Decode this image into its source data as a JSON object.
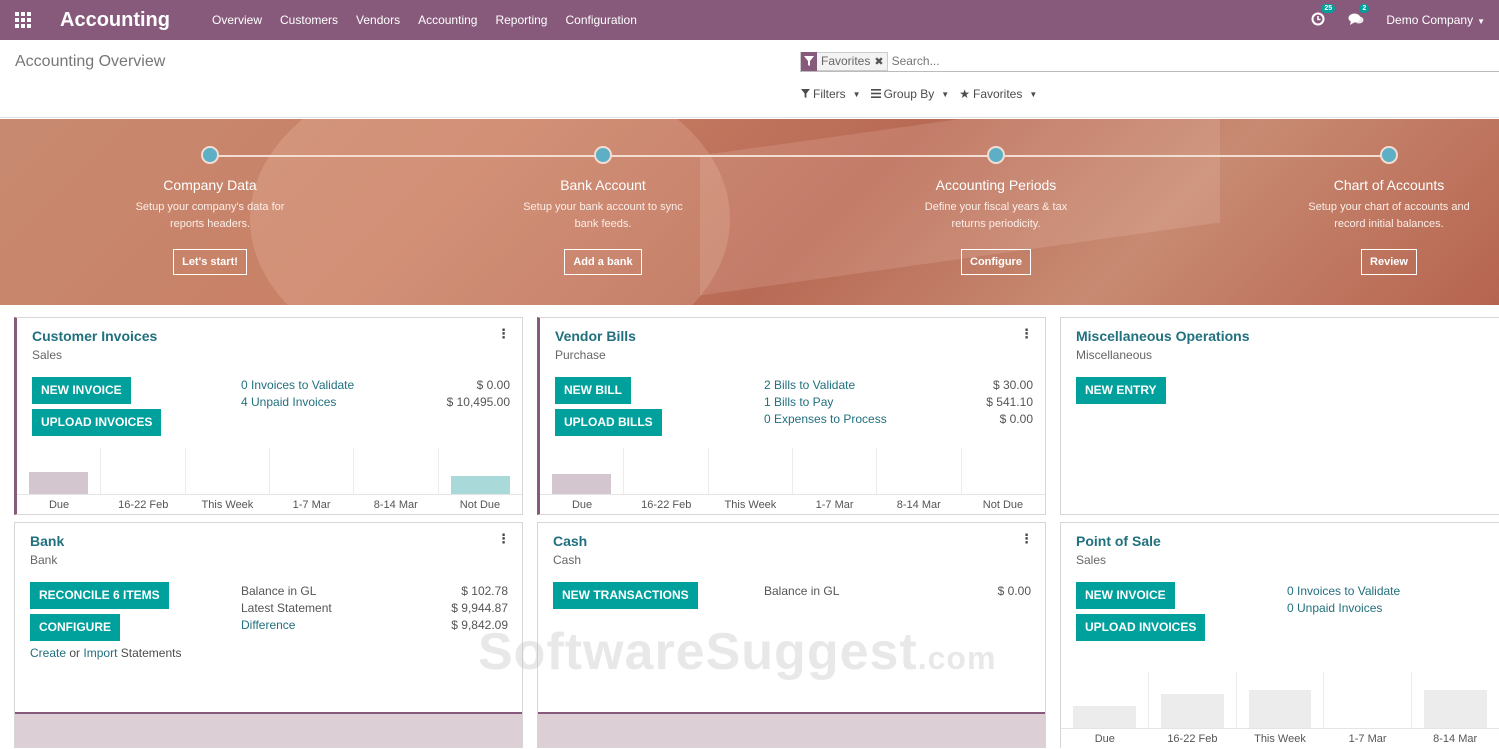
{
  "navbar": {
    "app_name": "Accounting",
    "menu": [
      "Overview",
      "Customers",
      "Vendors",
      "Accounting",
      "Reporting",
      "Configuration"
    ],
    "activity_count": "25",
    "message_count": "2",
    "company": "Demo Company"
  },
  "control_panel": {
    "title": "Accounting Overview",
    "search": {
      "facet": "Favorites",
      "placeholder": "Search..."
    },
    "filters_label": "Filters",
    "groupby_label": "Group By",
    "favorites_label": "Favorites"
  },
  "onboarding": {
    "steps": [
      {
        "title": "Company Data",
        "desc": "Setup your company's data for reports headers.",
        "button": "Let's start!"
      },
      {
        "title": "Bank Account",
        "desc": "Setup your bank account to sync bank feeds.",
        "button": "Add a bank"
      },
      {
        "title": "Accounting Periods",
        "desc": "Define your fiscal years & tax returns periodicity.",
        "button": "Configure"
      },
      {
        "title": "Chart of Accounts",
        "desc": "Setup your chart of accounts and record initial balances.",
        "button": "Review"
      }
    ]
  },
  "journals": {
    "customer_invoices": {
      "title": "Customer Invoices",
      "subtitle": "Sales",
      "buttons": [
        "NEW INVOICE",
        "UPLOAD INVOICES"
      ],
      "stats": [
        {
          "label": "0 Invoices to Validate",
          "value": "$ 0.00"
        },
        {
          "label": "4 Unpaid Invoices",
          "value": "$ 10,495.00"
        }
      ],
      "chart_labels": [
        "Due",
        "16-22 Feb",
        "This Week",
        "1-7 Mar",
        "8-14 Mar",
        "Not Due"
      ]
    },
    "vendor_bills": {
      "title": "Vendor Bills",
      "subtitle": "Purchase",
      "buttons": [
        "NEW BILL",
        "UPLOAD BILLS"
      ],
      "stats": [
        {
          "label": "2 Bills to Validate",
          "value": "$ 30.00"
        },
        {
          "label": "1 Bills to Pay",
          "value": "$ 541.10"
        },
        {
          "label": "0 Expenses to Process",
          "value": "$ 0.00"
        }
      ],
      "chart_labels": [
        "Due",
        "16-22 Feb",
        "This Week",
        "1-7 Mar",
        "8-14 Mar",
        "Not Due"
      ]
    },
    "misc": {
      "title": "Miscellaneous Operations",
      "subtitle": "Miscellaneous",
      "buttons": [
        "NEW ENTRY"
      ]
    },
    "bank": {
      "title": "Bank",
      "subtitle": "Bank",
      "buttons": [
        "RECONCILE 6 ITEMS",
        "CONFIGURE"
      ],
      "stats": [
        {
          "label": "Balance in GL",
          "value": "$ 102.78"
        },
        {
          "label": "Latest Statement",
          "value": "$ 9,944.87"
        },
        {
          "label": "Difference",
          "value": "$ 9,842.09"
        }
      ],
      "statements": {
        "create": "Create",
        "or": "or",
        "import": "Import",
        "suffix": "Statements"
      }
    },
    "cash": {
      "title": "Cash",
      "subtitle": "Cash",
      "buttons": [
        "NEW TRANSACTIONS"
      ],
      "stats": [
        {
          "label": "Balance in GL",
          "value": "$ 0.00"
        }
      ]
    },
    "pos": {
      "title": "Point of Sale",
      "subtitle": "Sales",
      "buttons": [
        "NEW INVOICE",
        "UPLOAD INVOICES"
      ],
      "stats": [
        {
          "label": "0 Invoices to Validate",
          "value": ""
        },
        {
          "label": "0 Unpaid Invoices",
          "value": ""
        }
      ],
      "chart_labels": [
        "Due",
        "16-22 Feb",
        "This Week",
        "1-7 Mar",
        "8-14 Mar"
      ]
    }
  },
  "watermark": {
    "main": "SoftwareSuggest",
    "suffix": ".com"
  },
  "colors": {
    "navbar": "#875a7b",
    "primary_button": "#00a09d",
    "link": "#21707e"
  }
}
